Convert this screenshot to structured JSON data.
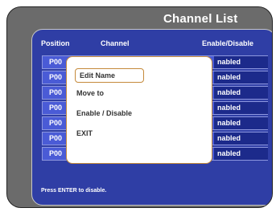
{
  "title": "Channel List",
  "table": {
    "headers": {
      "position": "Position",
      "channel": "Channel",
      "enable": "Enable/Disable"
    },
    "rows": [
      {
        "position": "P00",
        "status": "nabled"
      },
      {
        "position": "P00",
        "status": "nabled"
      },
      {
        "position": "P00",
        "status": "nabled"
      },
      {
        "position": "P00",
        "status": "nabled"
      },
      {
        "position": "P00",
        "status": "nabled"
      },
      {
        "position": "P00",
        "status": "nabled"
      },
      {
        "position": "P00",
        "status": "nabled"
      }
    ]
  },
  "hint": "Press ENTER to disable.",
  "menu": {
    "items": [
      "Edit Name",
      "Move to",
      "Enable / Disable",
      "EXIT"
    ],
    "selected": "Edit Name"
  },
  "colors": {
    "frame": "#6b6b6b",
    "panel": "#2f3ea5",
    "row": "#4a5bd6",
    "status_cell": "#1c2a8b",
    "menu_border": "#c58a3b"
  }
}
